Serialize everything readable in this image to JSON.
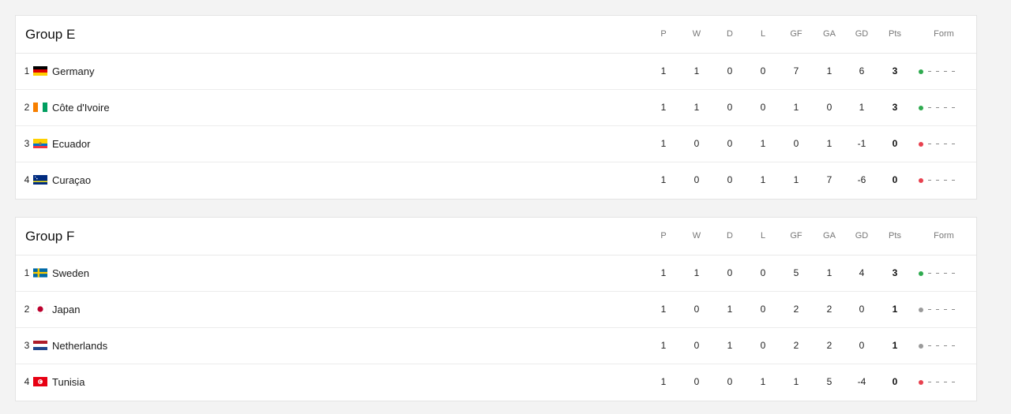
{
  "columns": {
    "p": "P",
    "w": "W",
    "d": "D",
    "l": "L",
    "gf": "GF",
    "ga": "GA",
    "gd": "GD",
    "pts": "Pts",
    "form": "Form"
  },
  "colors": {
    "win": "#2eaa4f",
    "draw": "#9a9a9a",
    "loss": "#e8414f"
  },
  "groups": [
    {
      "title": "Group E",
      "rows": [
        {
          "pos": "1",
          "team": "Germany",
          "flag": "germany-flag-icon",
          "p": "1",
          "w": "1",
          "d": "0",
          "l": "0",
          "gf": "7",
          "ga": "1",
          "gd": "6",
          "pts": "3",
          "form": "win"
        },
        {
          "pos": "2",
          "team": "Côte d'Ivoire",
          "flag": "cote-divoire-flag-icon",
          "p": "1",
          "w": "1",
          "d": "0",
          "l": "0",
          "gf": "1",
          "ga": "0",
          "gd": "1",
          "pts": "3",
          "form": "win"
        },
        {
          "pos": "3",
          "team": "Ecuador",
          "flag": "ecuador-flag-icon",
          "p": "1",
          "w": "0",
          "d": "0",
          "l": "1",
          "gf": "0",
          "ga": "1",
          "gd": "-1",
          "pts": "0",
          "form": "loss"
        },
        {
          "pos": "4",
          "team": "Curaçao",
          "flag": "curacao-flag-icon",
          "p": "1",
          "w": "0",
          "d": "0",
          "l": "1",
          "gf": "1",
          "ga": "7",
          "gd": "-6",
          "pts": "0",
          "form": "loss"
        }
      ]
    },
    {
      "title": "Group F",
      "rows": [
        {
          "pos": "1",
          "team": "Sweden",
          "flag": "sweden-flag-icon",
          "p": "1",
          "w": "1",
          "d": "0",
          "l": "0",
          "gf": "5",
          "ga": "1",
          "gd": "4",
          "pts": "3",
          "form": "win"
        },
        {
          "pos": "2",
          "team": "Japan",
          "flag": "japan-flag-icon",
          "p": "1",
          "w": "0",
          "d": "1",
          "l": "0",
          "gf": "2",
          "ga": "2",
          "gd": "0",
          "pts": "1",
          "form": "draw"
        },
        {
          "pos": "3",
          "team": "Netherlands",
          "flag": "netherlands-flag-icon",
          "p": "1",
          "w": "0",
          "d": "1",
          "l": "0",
          "gf": "2",
          "ga": "2",
          "gd": "0",
          "pts": "1",
          "form": "draw"
        },
        {
          "pos": "4",
          "team": "Tunisia",
          "flag": "tunisia-flag-icon",
          "p": "1",
          "w": "0",
          "d": "0",
          "l": "1",
          "gf": "1",
          "ga": "5",
          "gd": "-4",
          "pts": "0",
          "form": "loss"
        }
      ]
    }
  ]
}
